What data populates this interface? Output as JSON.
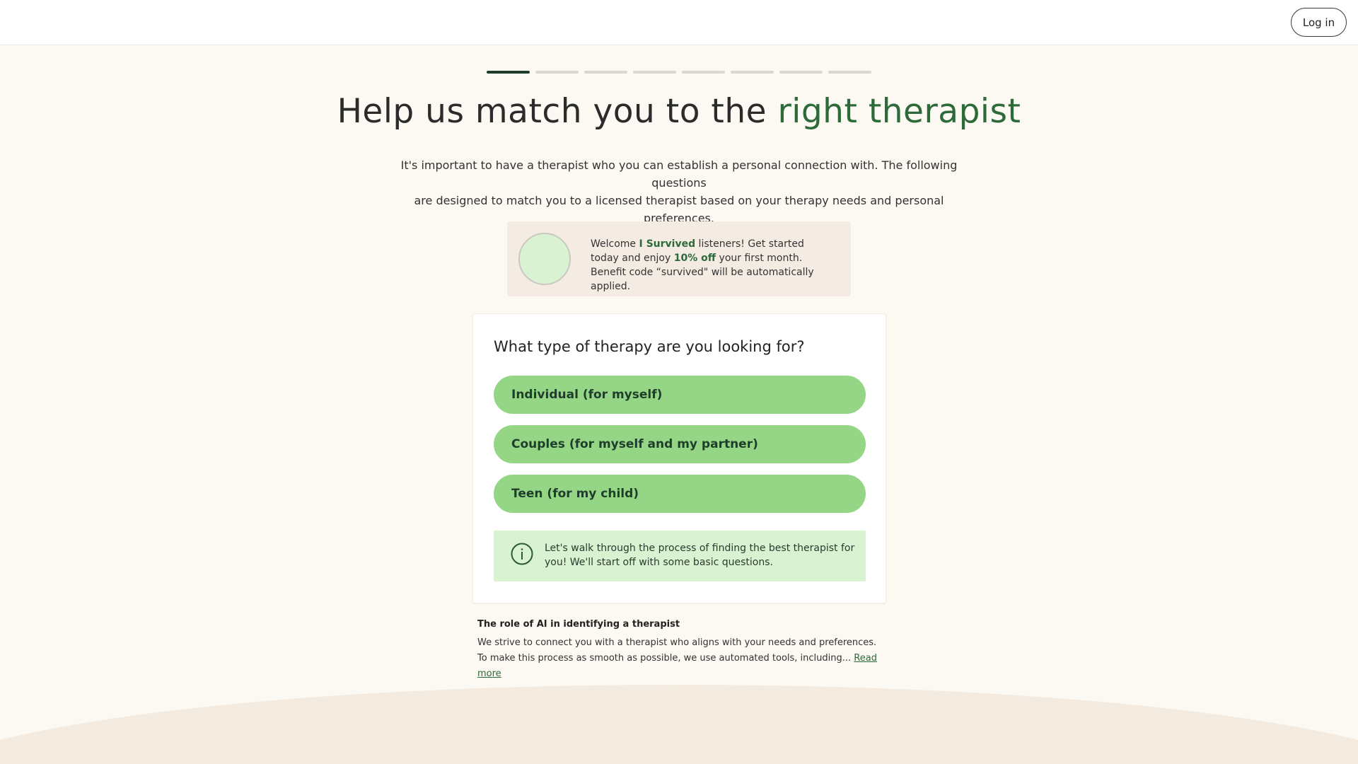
{
  "header": {
    "login_label": "Log in"
  },
  "progress": {
    "total_steps": 8,
    "current_step": 1
  },
  "hero": {
    "title_part1": "Help us match you to the ",
    "title_accent": "right therapist",
    "intro_line1": "It's important to have a therapist who you can establish a personal connection with. The following questions",
    "intro_line2": "are designed to match you to a licensed therapist based on your therapy needs and personal preferences."
  },
  "promo": {
    "text_pre": "Welcome ",
    "brand": "I Survived",
    "text_mid1": " listeners! Get started today and enjoy ",
    "discount": "10% off",
    "text_mid2": " your first month. Benefit code “survived\" will be automatically applied."
  },
  "question": {
    "title": "What type of therapy are you looking for?",
    "options": [
      "Individual (for myself)",
      "Couples (for myself and my partner)",
      "Teen (for my child)"
    ],
    "info": "Let's walk through the process of finding the best therapist for you! We'll start off with some basic questions."
  },
  "ai_section": {
    "title": "The role of AI in identifying a therapist",
    "body": "We strive to connect you with a therapist who aligns with your needs and preferences. To make this process as smooth as possible, we use automated tools, including... ",
    "read_more": "Read more"
  },
  "colors": {
    "background": "#fcf8f2",
    "accent_green": "#2d6a3a",
    "option_green": "#95d686",
    "info_green": "#d9f3d2",
    "promo_bg": "#f4ebe3",
    "wave": "#f3ebe0"
  }
}
